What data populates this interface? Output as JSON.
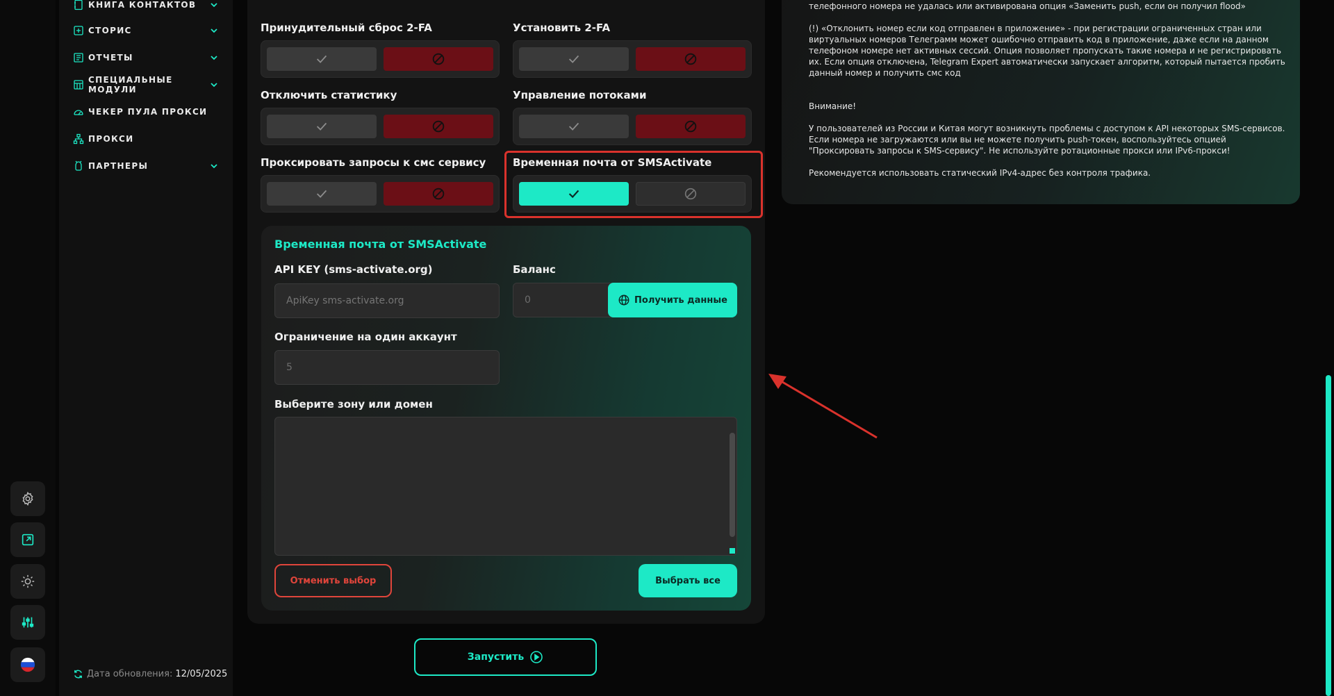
{
  "sidebar": {
    "items": [
      {
        "label": "КНИГА КОНТАКТОВ",
        "icon": "contacts-book-icon",
        "has_chevron": true
      },
      {
        "label": "СТОРИС",
        "icon": "stories-plus-icon",
        "has_chevron": true
      },
      {
        "label": "ОТЧЕТЫ",
        "icon": "reports-icon",
        "has_chevron": true
      },
      {
        "label": "СПЕЦИАЛЬНЫЕ МОДУЛИ",
        "icon": "modules-icon",
        "has_chevron": true
      },
      {
        "label": "ЧЕКЕР ПУЛА ПРОКСИ",
        "icon": "speedometer-icon",
        "has_chevron": false
      },
      {
        "label": "ПРОКСИ",
        "icon": "network-icon",
        "has_chevron": false
      },
      {
        "label": "ПАРТНЕРЫ",
        "icon": "partners-icon",
        "has_chevron": true
      }
    ],
    "update_label": "Дата обновления:",
    "update_value": "12/05/2025"
  },
  "settings": {
    "force_reset_2fa": {
      "label": "Принудительный сброс 2-FA",
      "value": false
    },
    "set_2fa": {
      "label": "Установить 2-FA",
      "value": false
    },
    "disable_stats": {
      "label": "Отключить статистику",
      "value": false
    },
    "thread_control": {
      "label": "Управление потоками",
      "value": false
    },
    "proxy_sms": {
      "label": "Проксировать запросы к смс сервису",
      "value": false
    },
    "temp_mail": {
      "label": "Временная почта от SMSActivate",
      "value": true
    }
  },
  "temp_mail_card": {
    "title": "Временная почта от SMSActivate",
    "api_key_label": "API KEY (sms-activate.org)",
    "api_key_placeholder": "ApiKey sms-activate.org",
    "balance_label": "Баланс",
    "balance_value": "0",
    "get_data_button": "Получить данные",
    "limit_label": "Ограничение на один аккаунт",
    "limit_value": "5",
    "zone_label": "Выберите зону или домен",
    "cancel_button": "Отменить выбор",
    "select_all_button": "Выбрать все"
  },
  "launch_button": "Запустить",
  "info": {
    "p1": "телефонного номера не удалась или активирована опция «Заменить push, если он получил flood»",
    "p2": "(!) «Отклонить номер если код отправлен в приложение» - при регистрации ограниченных стран или виртуальных номеров Телеграмм может ошибочно отправить код в приложение, даже если на данном телефоном номере нет активных сессий. Опция позволяет пропускать такие номера и не регистрировать их. Если опция отключена, Telegram Expert автоматически запускает алгоритм, который пытается пробить данный номер и получить смс код",
    "p3": "Внимание!",
    "p4": "У пользователей из России и Китая могут возникнуть проблемы с доступом к API некоторых SMS-сервисов. Если номера не загружаются или вы не можете получить push-токен, воспользуйтесь опцией \"Проксировать запросы к SMS-сервису\". Не используйте ротационные прокси или IPv6-прокси!",
    "p5": "Рекомендуется использовать статический IPv4-адрес без контроля трафика."
  },
  "colors": {
    "accent": "#1de9c6",
    "danger": "#6b0f16",
    "annotation": "#d9322c"
  }
}
